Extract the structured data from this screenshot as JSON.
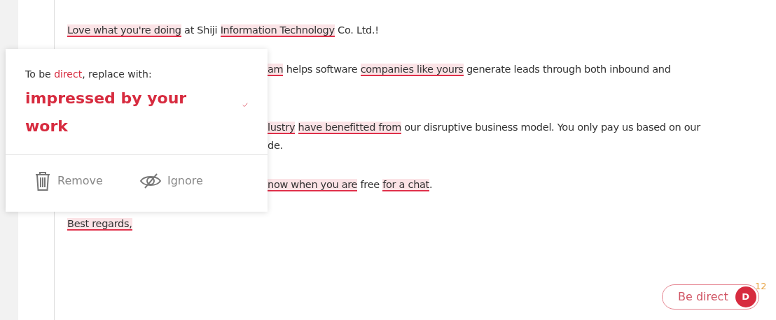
{
  "editor": {
    "lines": [
      {
        "segments": [
          {
            "text": "Love what you're doing",
            "flagged": true
          },
          {
            "text": " at Shiji ",
            "flagged": false
          },
          {
            "text": "Information Technology",
            "flagged": true
          },
          {
            "text": " Co. Ltd.!",
            "flagged": false
          }
        ]
      },
      {
        "segments": [
          {
            "text": "am",
            "flagged": true
          },
          {
            "text": " helps software ",
            "flagged": false
          },
          {
            "text": "companies like yours",
            "flagged": true
          },
          {
            "text": " generate leads through both inbound and",
            "flagged": false
          }
        ]
      },
      {
        "segments": [
          {
            "text": "lustry",
            "flagged": true
          },
          {
            "text": "have benefitted from",
            "flagged": true
          },
          {
            "text": " our disruptive business model. You only pay us based on our",
            "flagged": false
          }
        ]
      },
      {
        "segments": [
          {
            "text": "de.",
            "flagged": false
          }
        ]
      },
      {
        "segments": [
          {
            "text": "now when you are",
            "flagged": true
          },
          {
            "text": " free ",
            "flagged": false
          },
          {
            "text": "for a chat",
            "flagged": true
          },
          {
            "text": ".",
            "flagged": false
          }
        ]
      },
      {
        "segments": [
          {
            "text": "Best regards,",
            "flagged": true
          }
        ]
      }
    ]
  },
  "suggestion_popup": {
    "prompt": "To be **direct**, replace with:",
    "replacement": "impressed by your work",
    "actions": [
      {
        "kind": "remove",
        "label": "Remove"
      },
      {
        "kind": "ignore",
        "label": "Ignore"
      }
    ]
  },
  "tone_button": {
    "label": "Be direct",
    "avatar": "D",
    "count": "12"
  }
}
